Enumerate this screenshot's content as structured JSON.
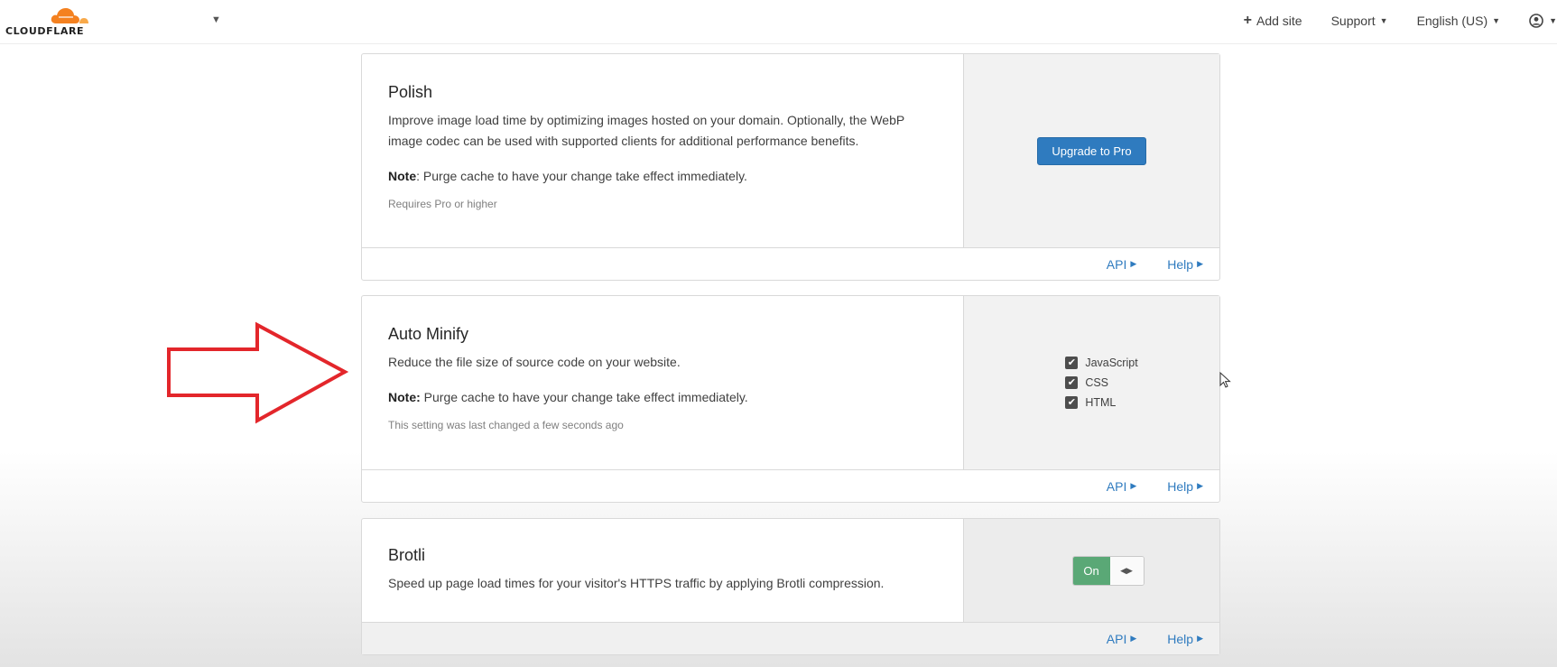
{
  "header": {
    "logo_text": "CLOUDFLARE",
    "add_site": "Add site",
    "support": "Support",
    "language": "English (US)"
  },
  "colors": {
    "brand_orange": "#f48120",
    "link_blue": "#2f7bbf",
    "toggle_green": "#5aa876",
    "annotation_red": "#e3262b"
  },
  "icons": [
    "cloud-logo-icon",
    "plus-icon",
    "caret-down-icon",
    "user-icon",
    "triangle-right-icon",
    "check-icon",
    "resize-handle-icon",
    "red-arrow-annotation",
    "mouse-cursor-icon"
  ],
  "cards": [
    {
      "title": "Polish",
      "description": "Improve image load time by optimizing images hosted on your domain. Optionally, the WebP image codec can be used with supported clients for additional performance benefits.",
      "note_label": "Note",
      "note_text": ": Purge cache to have your change take effect immediately.",
      "meta": "Requires Pro or higher",
      "action_label": "Upgrade to Pro",
      "api_label": "API",
      "help_label": "Help"
    },
    {
      "title": "Auto Minify",
      "description": "Reduce the file size of source code on your website.",
      "note_label": "Note:",
      "note_text": " Purge cache to have your change take effect immediately.",
      "meta": "This setting was last changed a few seconds ago",
      "options": [
        {
          "label": "JavaScript",
          "checked": true
        },
        {
          "label": "CSS",
          "checked": true
        },
        {
          "label": "HTML",
          "checked": true
        }
      ],
      "api_label": "API",
      "help_label": "Help"
    },
    {
      "title": "Brotli",
      "description": "Speed up page load times for your visitor's HTTPS traffic by applying Brotli compression.",
      "toggle_label": "On",
      "toggle_state": "on",
      "api_label": "API",
      "help_label": "Help"
    }
  ]
}
